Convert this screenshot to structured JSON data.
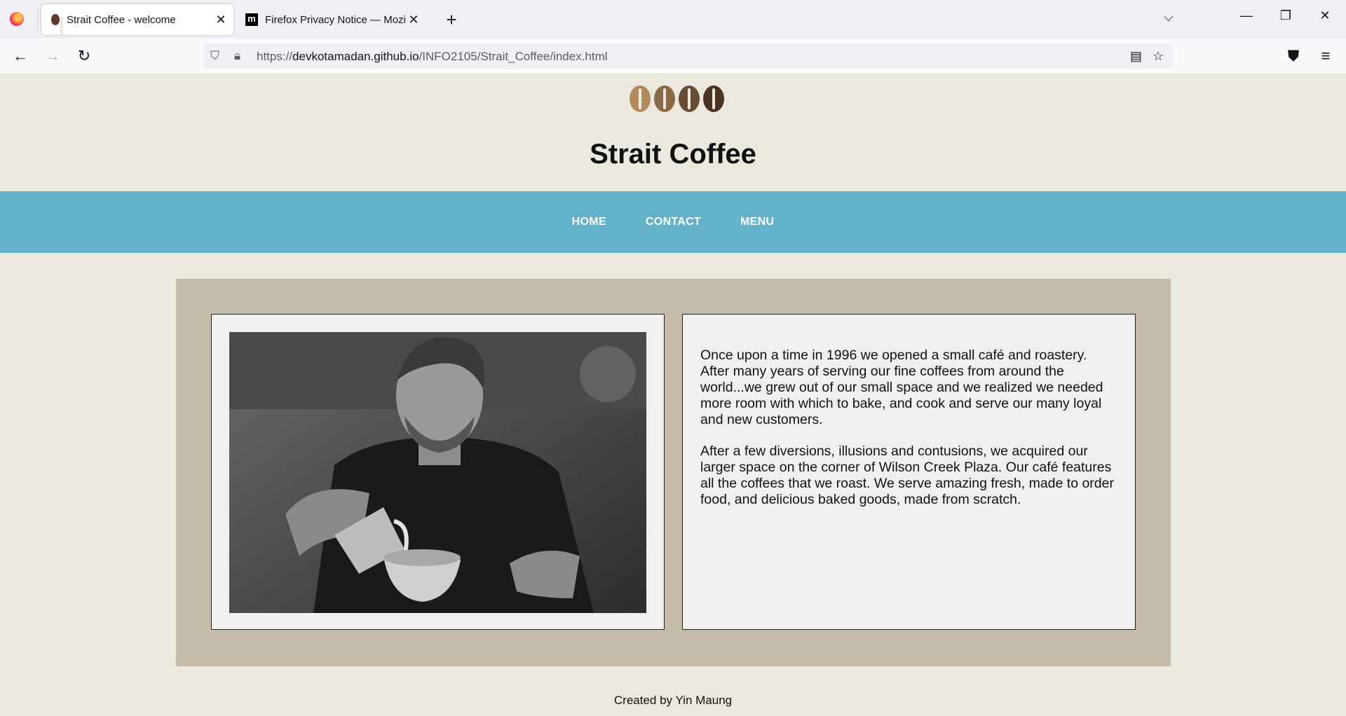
{
  "browser": {
    "tabs": [
      {
        "title": "Strait Coffee - welcome",
        "active": true
      },
      {
        "title": "Firefox Privacy Notice — Mozilla",
        "active": false
      }
    ],
    "url": {
      "scheme": "https://",
      "host": "devkotamadan.github.io",
      "path": "/INFO2105/Strait_Coffee/index.html"
    },
    "icons": [
      "firefox-logo",
      "back",
      "forward",
      "reload",
      "shield",
      "lock",
      "reader-view",
      "bookmark-star",
      "pocket",
      "app-menu",
      "tab-list",
      "minimize",
      "restore",
      "close-window",
      "new-tab"
    ]
  },
  "site": {
    "title": "Strait Coffee",
    "nav": [
      "HOME",
      "CONTACT",
      "MENU"
    ],
    "paragraphs": [
      "Once upon a time in 1996 we opened a small café and roastery. After many years of serving our fine coffees from around the world...we grew out of our small space and we realized we needed more room with which to bake, and cook and serve our many loyal and new customers.",
      "After a few diversions, illusions and contusions, we acquired our larger space on the corner of Wilson Creek Plaza. Our café features all the coffees that we roast. We serve amazing fresh, made to order food, and delicious baked goods, made from scratch."
    ],
    "footer": "Created by Yin Maung"
  },
  "colors": {
    "page_bg": "#ebe9de",
    "nav_bg": "#63b2c9",
    "content_bg": "#c5bba9",
    "card_bg": "#f0f0f0"
  }
}
